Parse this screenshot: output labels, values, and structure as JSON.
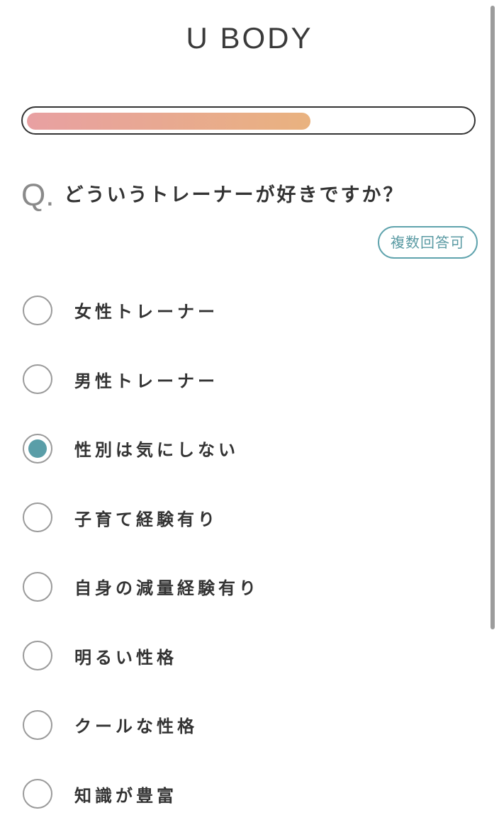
{
  "header": {
    "title": "U BODY"
  },
  "progress": {
    "fraction": 0.64,
    "fill_colors": [
      "#e8a0a2",
      "#e9b27f"
    ]
  },
  "question": {
    "prefix": "Q",
    "dot": ".",
    "text": "どういうトレーナーが好きですか？",
    "badge": "複数回答可"
  },
  "options": [
    {
      "label": "女性トレーナー",
      "selected": false
    },
    {
      "label": "男性トレーナー",
      "selected": false
    },
    {
      "label": "性別は気にしない",
      "selected": true
    },
    {
      "label": "子育て経験有り",
      "selected": false
    },
    {
      "label": "自身の減量経験有り",
      "selected": false
    },
    {
      "label": "明るい性格",
      "selected": false
    },
    {
      "label": "クールな性格",
      "selected": false
    },
    {
      "label": "知識が豊富",
      "selected": false
    }
  ],
  "colors": {
    "accent": "#5a9ea8",
    "badge_border": "#5fa3ad",
    "text": "#333333"
  }
}
